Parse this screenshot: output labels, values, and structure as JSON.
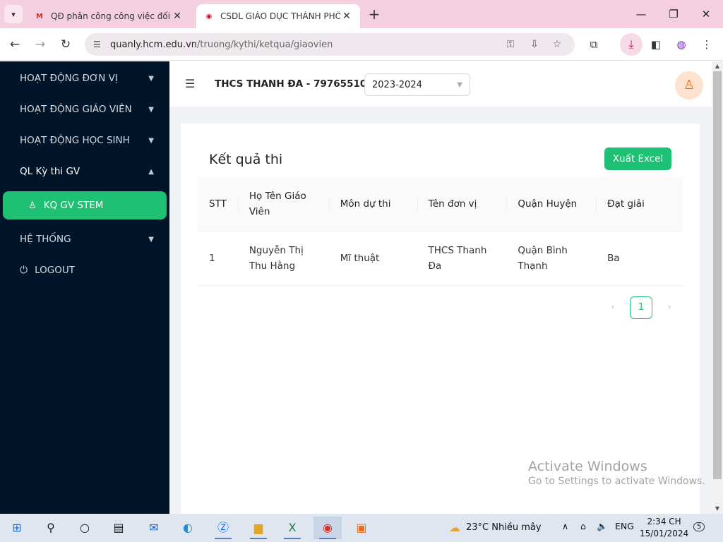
{
  "browser": {
    "tabs": [
      {
        "title": "QĐ phân công công việc đối với",
        "favicon": "gmail-icon",
        "active": false
      },
      {
        "title": "CSDL GIÁO DỤC THÀNH PHỐ HỒ",
        "favicon": "hcm-edu-icon",
        "active": true
      }
    ],
    "url_host": "quanly.hcm.edu.vn",
    "url_path": "/truong/kythi/ketqua/giaovien"
  },
  "sidebar": {
    "items": [
      {
        "label": "HOẠT ĐỘNG ĐƠN VỊ"
      },
      {
        "label": "HOẠT ĐỘNG GIÁO VIÊN"
      },
      {
        "label": "HOẠT ĐỘNG HỌC SINH"
      },
      {
        "label": "QL Kỳ thi GV"
      }
    ],
    "sub_active": "KQ GV STEM",
    "system": "HỆ THỐNG",
    "logout": "LOGOUT"
  },
  "header": {
    "school": "THCS THANH ĐA - 79765510",
    "year": "2023-2024"
  },
  "page": {
    "title": "Kết quả thi",
    "export_label": "Xuất Excel"
  },
  "table": {
    "columns": [
      "STT",
      "Họ Tên Giáo Viên",
      "Môn dự thi",
      "Tên đơn vị",
      "Quận Huyện",
      "Đạt giải"
    ],
    "rows": [
      [
        "1",
        "Nguyễn Thị Thu Hằng",
        "Mĩ thuật",
        "THCS Thanh Đa",
        "Quận Bình Thạnh",
        "Ba"
      ]
    ]
  },
  "pagination": {
    "current": "1"
  },
  "watermark": {
    "line1": "Activate Windows",
    "line2": "Go to Settings to activate Windows."
  },
  "taskbar": {
    "weather": "23°C  Nhiều mây",
    "lang": "ENG",
    "time": "2:34 CH",
    "date": "15/01/2024",
    "notifications": "5"
  },
  "colors": {
    "sidebar_bg": "#001529",
    "accent": "#1ec173",
    "tabstrip": "#f4cfe0"
  }
}
